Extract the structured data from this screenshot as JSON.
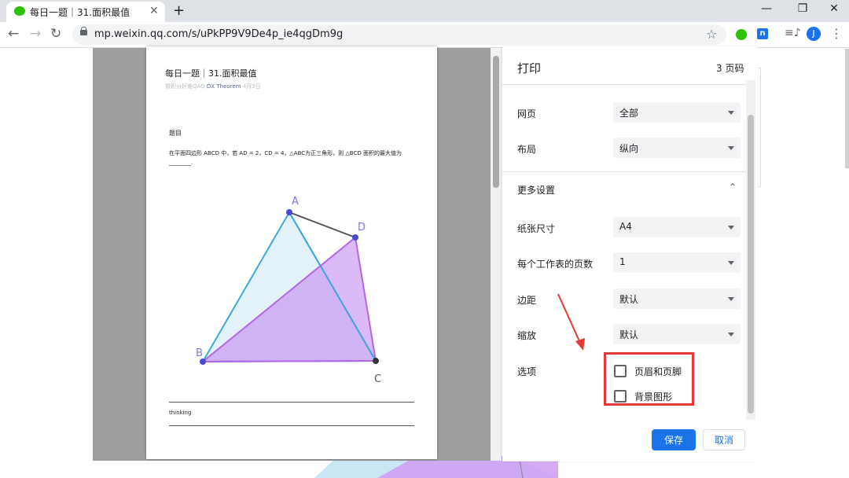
{
  "browser": {
    "tab_title": "每日一题｜31.面积最值",
    "tab_close": "✕",
    "new_tab": "+",
    "window_minimize": "—",
    "window_restore": "❐",
    "window_close": "✕",
    "back": "←",
    "forward": "→",
    "reload": "↻",
    "url": "mp.weixin.qq.com/s/uPkPP9V9De4p_ie4qgDm9g",
    "star": "☆",
    "ext_letter": "n",
    "media": "≡♪",
    "avatar_letter": "J",
    "menu": "⋮"
  },
  "preview": {
    "title": "每日一题｜31.面积最值",
    "meta_source": "微积分好难QAQ",
    "meta_author": "DX Theorem",
    "meta_date": "4月3日",
    "heading": "题目",
    "problem": "在平面四边形 ABCD 中，若 AD = 2，CD = 4，△ABC为正三角形，则 △BCD 面积的最大值为________.",
    "figure_labels": {
      "a": "A",
      "b": "B",
      "c": "C",
      "d": "D"
    },
    "thinking": "thinking"
  },
  "print_panel": {
    "title": "打印",
    "page_count": "3 页码",
    "rows": [
      {
        "label": "网页",
        "value": "全部"
      },
      {
        "label": "布局",
        "value": "纵向"
      }
    ],
    "more_settings": "更多设置",
    "more_chevron": "⌃",
    "more_rows": [
      {
        "label": "纸张尺寸",
        "value": "A4"
      },
      {
        "label": "每个工作表的页数",
        "value": "1"
      },
      {
        "label": "边距",
        "value": "默认"
      },
      {
        "label": "缩放",
        "value": "默认"
      }
    ],
    "options_label": "选项",
    "options": [
      {
        "label": "页眉和页脚",
        "checked": false
      },
      {
        "label": "背景图形",
        "checked": false
      }
    ],
    "save": "保存",
    "cancel": "取消"
  },
  "colors": {
    "accent": "#1a73e8",
    "highlight": "#e53935",
    "triangle_blue": "#3ea8de",
    "triangle_purple": "#c080f0"
  }
}
